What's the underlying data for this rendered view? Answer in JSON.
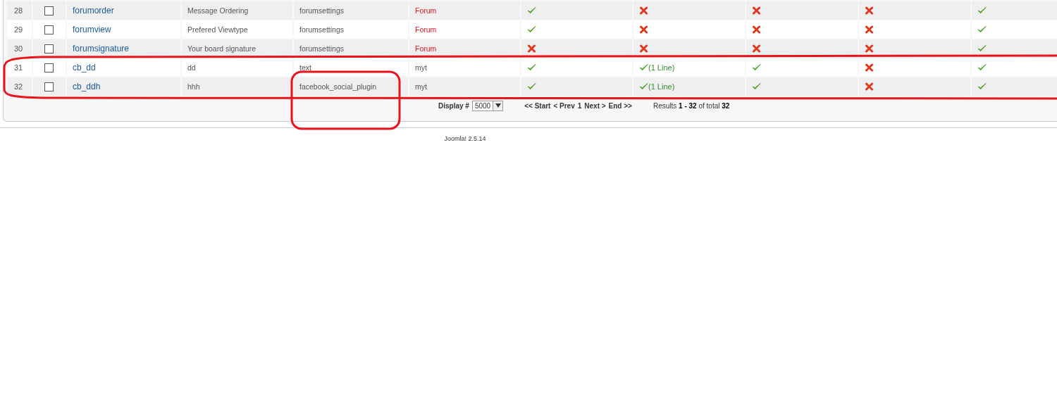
{
  "table": {
    "rows": [
      {
        "number": "28",
        "checked": false,
        "name": "forumorder",
        "title": "Message Ordering",
        "type": "forumsettings",
        "tab": {
          "label": "Forum",
          "color": "#e8141c"
        },
        "flags": [
          {
            "on": true
          },
          {
            "on": false
          },
          {
            "on": false
          },
          {
            "on": false
          },
          {
            "on": true
          }
        ]
      },
      {
        "number": "29",
        "checked": false,
        "name": "forumview",
        "title": "Prefered Viewtype",
        "type": "forumsettings",
        "tab": {
          "label": "Forum",
          "color": "#e8141c"
        },
        "flags": [
          {
            "on": true
          },
          {
            "on": false
          },
          {
            "on": false
          },
          {
            "on": false
          },
          {
            "on": true
          }
        ]
      },
      {
        "number": "30",
        "checked": false,
        "name": "forumsignature",
        "title": "Your board signature",
        "type": "forumsettings",
        "tab": {
          "label": "Forum",
          "color": "#e8141c"
        },
        "flags": [
          {
            "on": false
          },
          {
            "on": false
          },
          {
            "on": false
          },
          {
            "on": false
          },
          {
            "on": true
          }
        ]
      },
      {
        "number": "31",
        "checked": false,
        "name": "cb_dd",
        "title": "dd",
        "type": "text",
        "tab": {
          "label": "myt",
          "color": "#555555"
        },
        "flags": [
          {
            "on": true
          },
          {
            "on": true,
            "note": "(1 Line)"
          },
          {
            "on": true
          },
          {
            "on": false
          },
          {
            "on": true
          }
        ]
      },
      {
        "number": "32",
        "checked": false,
        "name": "cb_ddh",
        "title": "hhh",
        "type": "facebook_social_plugin",
        "tab": {
          "label": "myt",
          "color": "#555555"
        },
        "flags": [
          {
            "on": true
          },
          {
            "on": true,
            "note": "(1 Line)"
          },
          {
            "on": true
          },
          {
            "on": false
          },
          {
            "on": true
          }
        ]
      }
    ]
  },
  "pagination": {
    "display_label": "Display #",
    "display_value": "5000",
    "links": [
      "<< Start",
      "< Prev",
      "1",
      "Next >",
      "End >>"
    ],
    "results": "Results **1 - 32** of total **32**"
  },
  "footer": {
    "version": "Joomla! 2.5.14"
  }
}
